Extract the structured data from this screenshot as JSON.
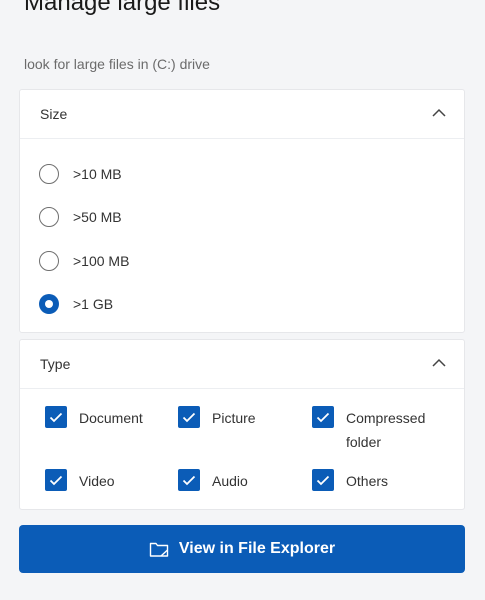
{
  "header": {
    "title": "Manage large files",
    "subtitle": "look for large files in (C:) drive"
  },
  "size_section": {
    "title": "Size",
    "expanded": true,
    "options": [
      {
        "label": ">10 MB",
        "selected": false
      },
      {
        "label": ">50 MB",
        "selected": false
      },
      {
        "label": ">100 MB",
        "selected": false
      },
      {
        "label": ">1 GB",
        "selected": true
      }
    ]
  },
  "type_section": {
    "title": "Type",
    "expanded": true,
    "options": [
      {
        "label": "Document",
        "checked": true
      },
      {
        "label": "Picture",
        "checked": true
      },
      {
        "label_line1": "Compressed",
        "label_line2": "folder",
        "checked": true
      },
      {
        "label": "Video",
        "checked": true
      },
      {
        "label": "Audio",
        "checked": true
      },
      {
        "label": "Others",
        "checked": true
      }
    ]
  },
  "action": {
    "label": "View in File Explorer",
    "icon": "file-explorer-icon"
  },
  "colors": {
    "accent": "#0b5cb7",
    "background": "#f4f5f7"
  }
}
